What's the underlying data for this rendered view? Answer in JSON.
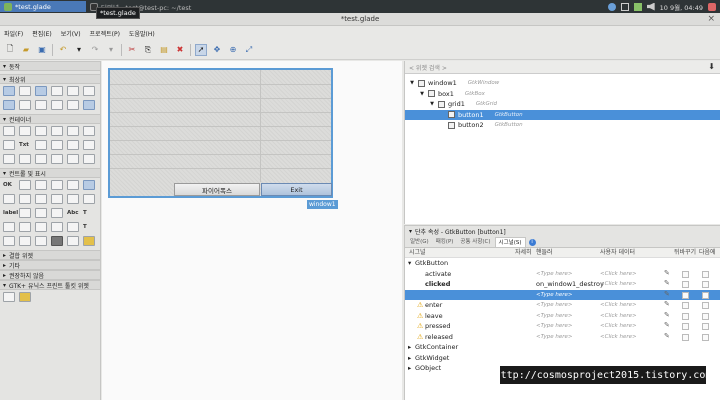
{
  "taskbar": {
    "active_task": "*test.glade",
    "inactive_task": "터미널 - test@test-pc: ~/test",
    "clock": "10 9월, 04:49"
  },
  "tooltip": "*test.glade",
  "window": {
    "title": "*test.glade",
    "close": "×"
  },
  "menu": [
    "파일(F)",
    "편집(E)",
    "보기(V)",
    "프로젝트(P)",
    "도움말(H)"
  ],
  "palette": {
    "sections": [
      {
        "label": "동작",
        "icon": "triangle-down-icon"
      },
      {
        "label": "최상위",
        "icon": "triangle-down-icon"
      },
      {
        "label": "컨테이너",
        "icon": "triangle-down-icon"
      },
      {
        "label": "컨트롤 및 표시",
        "icon": "triangle-down-icon"
      },
      {
        "label": "결합 위젯",
        "icon": "triangle-right-icon"
      },
      {
        "label": "기타",
        "icon": "triangle-right-icon"
      },
      {
        "label": "권장하지 않음",
        "icon": "triangle-right-icon"
      },
      {
        "label": "GTK+ 유닉스 프린트 툴킷 위젯",
        "icon": "triangle-down-icon"
      }
    ],
    "ctrl_text": {
      "ok": "OK",
      "label": "label",
      "abc": "Abc",
      "t1": "T",
      "t2": "T"
    }
  },
  "canvas": {
    "button1": "파이어폭스",
    "button2": "Exit",
    "window_label": "window1"
  },
  "inspector": {
    "search_placeholder": "< 위젯 검색 >",
    "tree": [
      {
        "name": "window1",
        "cls": "GtkWindow",
        "depth": 0,
        "arrow": "▼"
      },
      {
        "name": "box1",
        "cls": "GtkBox",
        "depth": 1,
        "arrow": "▼"
      },
      {
        "name": "grid1",
        "cls": "GtkGrid",
        "depth": 2,
        "arrow": "▼"
      },
      {
        "name": "button1",
        "cls": "GtkButton",
        "depth": 3,
        "arrow": "",
        "selected": true
      },
      {
        "name": "button2",
        "cls": "GtkButton",
        "depth": 3,
        "arrow": ""
      }
    ]
  },
  "props": {
    "title": "단추 속성 - GtkButton [button1]",
    "tabs": [
      "일반(G)",
      "패킹(P)",
      "공통 사항(C)",
      "시그널(S)"
    ],
    "active_tab": "시그널(S)",
    "columns": [
      "시그널",
      "자세히",
      "핸들러",
      "사용자 데이터",
      "뒤바꾸기",
      "다음에"
    ],
    "group_open": "GtkButton",
    "signals": [
      {
        "name": "activate",
        "handler": "<Type here>",
        "data": "<Click here>",
        "bold": false,
        "warn": false
      },
      {
        "name": "clicked",
        "handler": "on_window1_destroy",
        "data": "<Click here>",
        "bold": true,
        "warn": false
      },
      {
        "name": "",
        "handler": "<Type here>",
        "data": "",
        "bold": false,
        "warn": false,
        "selected": true
      },
      {
        "name": "enter",
        "handler": "<Type here>",
        "data": "<Click here>",
        "bold": false,
        "warn": true
      },
      {
        "name": "leave",
        "handler": "<Type here>",
        "data": "<Click here>",
        "bold": false,
        "warn": true
      },
      {
        "name": "pressed",
        "handler": "<Type here>",
        "data": "<Click here>",
        "bold": false,
        "warn": true
      },
      {
        "name": "released",
        "handler": "<Type here>",
        "data": "<Click here>",
        "bold": false,
        "warn": true
      }
    ],
    "groups_closed": [
      "GtkContainer",
      "GtkWidget",
      "GObject"
    ]
  },
  "watermark": "http://cosmosproject2015.tistory.com"
}
